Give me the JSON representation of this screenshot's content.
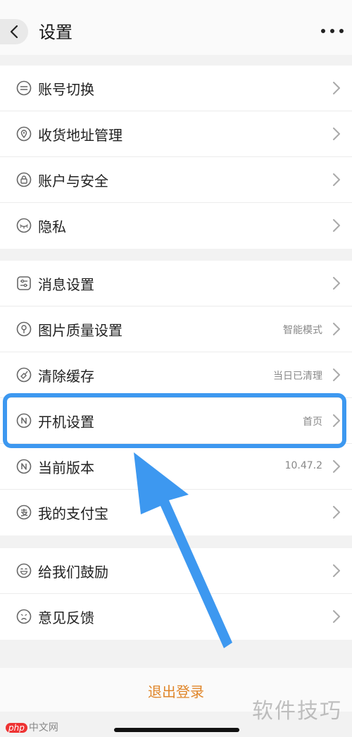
{
  "header": {
    "title": "设置"
  },
  "groups": [
    {
      "items": [
        {
          "label": "账号切换",
          "value": "",
          "icon": "switch-account-icon"
        },
        {
          "label": "收货地址管理",
          "value": "",
          "icon": "location-pin-icon"
        },
        {
          "label": "账户与安全",
          "value": "",
          "icon": "lock-icon"
        },
        {
          "label": "隐私",
          "value": "",
          "icon": "eye-closed-icon"
        }
      ]
    },
    {
      "items": [
        {
          "label": "消息设置",
          "value": "",
          "icon": "sliders-icon"
        },
        {
          "label": "图片质量设置",
          "value": "智能模式",
          "icon": "flower-icon"
        },
        {
          "label": "清除缓存",
          "value": "当日已清理",
          "icon": "broom-icon"
        },
        {
          "label": "开机设置",
          "value": "首页",
          "icon": "n-circle-icon"
        },
        {
          "label": "当前版本",
          "value": "10.47.2",
          "icon": "n-circle-icon"
        },
        {
          "label": "我的支付宝",
          "value": "",
          "icon": "alipay-icon"
        }
      ]
    },
    {
      "items": [
        {
          "label": "给我们鼓励",
          "value": "",
          "icon": "smile-icon"
        },
        {
          "label": "意见反馈",
          "value": "",
          "icon": "frown-icon"
        }
      ]
    }
  ],
  "footer": {
    "logout_label": "退出登录"
  },
  "watermark": {
    "text": "软件技巧"
  },
  "site_logo": {
    "badge": "php",
    "text": "中文网"
  },
  "colors": {
    "highlight": "#3d98f0",
    "logout": "#e0862a"
  }
}
